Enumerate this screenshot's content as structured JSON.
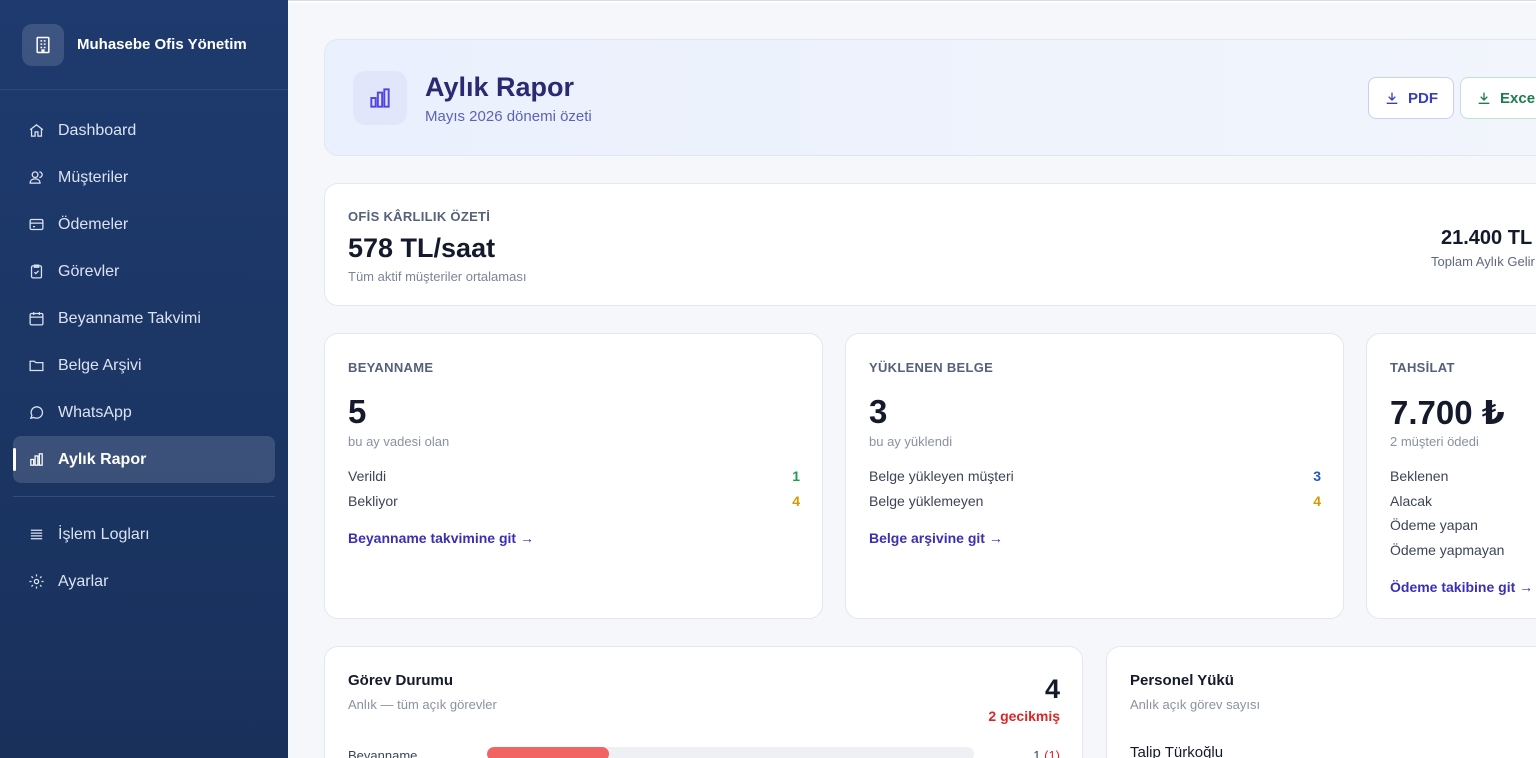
{
  "app": {
    "name": "Muhasebe Ofis Yönetim"
  },
  "sidebar": {
    "items": [
      {
        "label": "Dashboard",
        "icon": "home-icon"
      },
      {
        "label": "Müşteriler",
        "icon": "users-icon"
      },
      {
        "label": "Ödemeler",
        "icon": "credit-card-icon"
      },
      {
        "label": "Görevler",
        "icon": "clipboard-check-icon"
      },
      {
        "label": "Beyanname Takvimi",
        "icon": "calendar-icon"
      },
      {
        "label": "Belge Arşivi",
        "icon": "folder-icon"
      },
      {
        "label": "WhatsApp",
        "icon": "chat-bubble-icon"
      },
      {
        "label": "Aylık Rapor",
        "icon": "bar-chart-icon",
        "active": true
      }
    ],
    "secondary": [
      {
        "label": "İşlem Logları",
        "icon": "list-icon"
      },
      {
        "label": "Ayarlar",
        "icon": "gear-icon"
      }
    ]
  },
  "header": {
    "title": "Aylık Rapor",
    "subtitle": "Mayıs 2026 dönemi özeti",
    "pdf_label": "PDF",
    "excel_label": "Excel"
  },
  "profit": {
    "eyebrow": "OFİS KÂRLILIK ÖZETİ",
    "value": "578 TL/saat",
    "note": "Tüm aktif müşteriler ortalaması",
    "revenue_value": "21.400 TL",
    "revenue_label": "Toplam Aylık Gelir"
  },
  "cards": {
    "beyanname": {
      "eyebrow": "BEYANNAME",
      "value": "5",
      "note": "bu ay vadesi olan",
      "rows": [
        {
          "label": "Verildi",
          "value": "1"
        },
        {
          "label": "Bekliyor",
          "value": "4"
        }
      ],
      "link": "Beyanname takvimine git →"
    },
    "belge": {
      "eyebrow": "YÜKLENEN BELGE",
      "value": "3",
      "note": "bu ay yüklendi",
      "rows": [
        {
          "label": "Belge yükleyen müşteri",
          "value": "3"
        },
        {
          "label": "Belge yüklemeyen",
          "value": "4"
        }
      ],
      "link": "Belge arşivine git →"
    },
    "tahsilat": {
      "eyebrow": "TAHSİLAT",
      "value": "7.700 ₺",
      "note": "2 müşteri ödedi",
      "rows": [
        {
          "label": "Beklenen"
        },
        {
          "label": "Alacak"
        },
        {
          "label": "Ödeme yapan"
        },
        {
          "label": "Ödeme yapmayan"
        }
      ],
      "link": "Ödeme takibine git →"
    }
  },
  "tasks": {
    "title": "Görev Durumu",
    "subtitle": "Anlık — tüm açık görevler",
    "count": "4",
    "late": "2 gecikmiş",
    "bars": [
      {
        "label": "Beyanname",
        "value": "1",
        "late": "(1)",
        "fill_fraction": 0.25
      }
    ]
  },
  "staff": {
    "title": "Personel Yükü",
    "subtitle": "Anlık açık görev sayısı",
    "people": [
      {
        "name": "Talip Türkoğlu"
      }
    ]
  },
  "colors": {
    "sidebar_bg": "#1e3a6e",
    "accent": "#3b2fb3",
    "green": "#16a34a",
    "amber": "#d59a00",
    "blue": "#2557c7",
    "danger": "#dc2626"
  }
}
